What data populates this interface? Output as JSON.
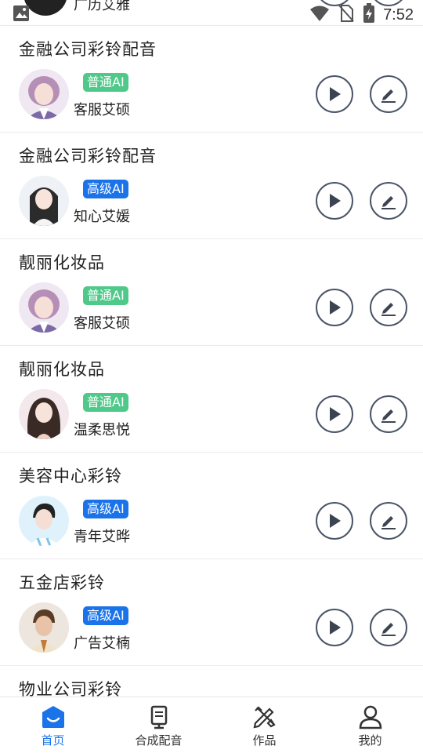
{
  "status_bar": {
    "time": "7:52"
  },
  "peek_item": {
    "voice_name": "广历艾雅"
  },
  "items": [
    {
      "title": "金融公司彩铃配音",
      "badge": "普通AI",
      "tier": "normal",
      "voice_name": "客服艾硕"
    },
    {
      "title": "金融公司彩铃配音",
      "badge": "高级AI",
      "tier": "advanced",
      "voice_name": "知心艾媛"
    },
    {
      "title": "靓丽化妆品",
      "badge": "普通AI",
      "tier": "normal",
      "voice_name": "客服艾硕"
    },
    {
      "title": "靓丽化妆品",
      "badge": "普通AI",
      "tier": "normal",
      "voice_name": "温柔思悦"
    },
    {
      "title": "美容中心彩铃",
      "badge": "高级AI",
      "tier": "advanced",
      "voice_name": "青年艾晔"
    },
    {
      "title": "五金店彩铃",
      "badge": "高级AI",
      "tier": "advanced",
      "voice_name": "广告艾楠"
    }
  ],
  "partial_item": {
    "title": "物业公司彩铃"
  },
  "tabbar": {
    "tabs": [
      {
        "label": "首页",
        "icon": "home-icon",
        "active": true
      },
      {
        "label": "合成配音",
        "icon": "microphone-icon",
        "active": false
      },
      {
        "label": "作品",
        "icon": "works-icon",
        "active": false
      },
      {
        "label": "我的",
        "icon": "profile-icon",
        "active": false
      }
    ]
  },
  "colors": {
    "accent": "#1a73e8",
    "normal_badge": "#4fc98a",
    "advanced_badge": "#1a73e8",
    "button_outline": "#4a5568"
  }
}
